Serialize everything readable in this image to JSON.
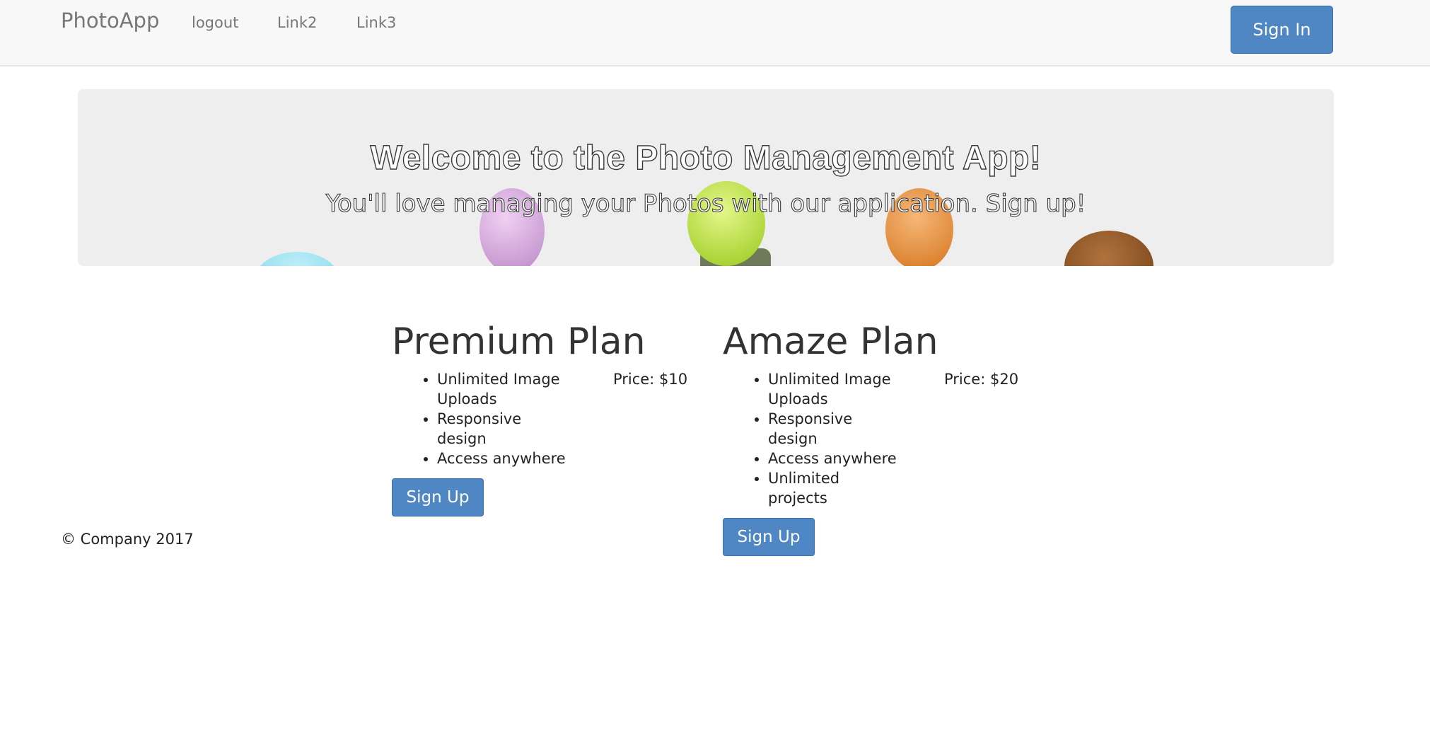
{
  "navbar": {
    "brand": "PhotoApp",
    "links": [
      "logout",
      "Link2",
      "Link3"
    ],
    "signin_label": "Sign In"
  },
  "hero": {
    "title": "Welcome to the Photo Management App!",
    "subtitle": "You'll love managing your Photos with our application. Sign up!"
  },
  "plans": [
    {
      "title": "Premium Plan",
      "features": [
        "Unlimited Image Uploads",
        "Responsive design",
        "Access anywhere"
      ],
      "price": "Price: $10",
      "button_label": "Sign Up"
    },
    {
      "title": "Amaze Plan",
      "features": [
        "Unlimited Image Uploads",
        "Responsive design",
        "Access anywhere",
        "Unlimited projects"
      ],
      "price": "Price: $20",
      "button_label": "Sign Up"
    }
  ],
  "footer": {
    "copyright": "© Company 2017"
  },
  "colors": {
    "primary_button": "#4f87c5",
    "navbar_bg": "#f8f8f8",
    "jumbotron_bg": "#eeeeee"
  }
}
